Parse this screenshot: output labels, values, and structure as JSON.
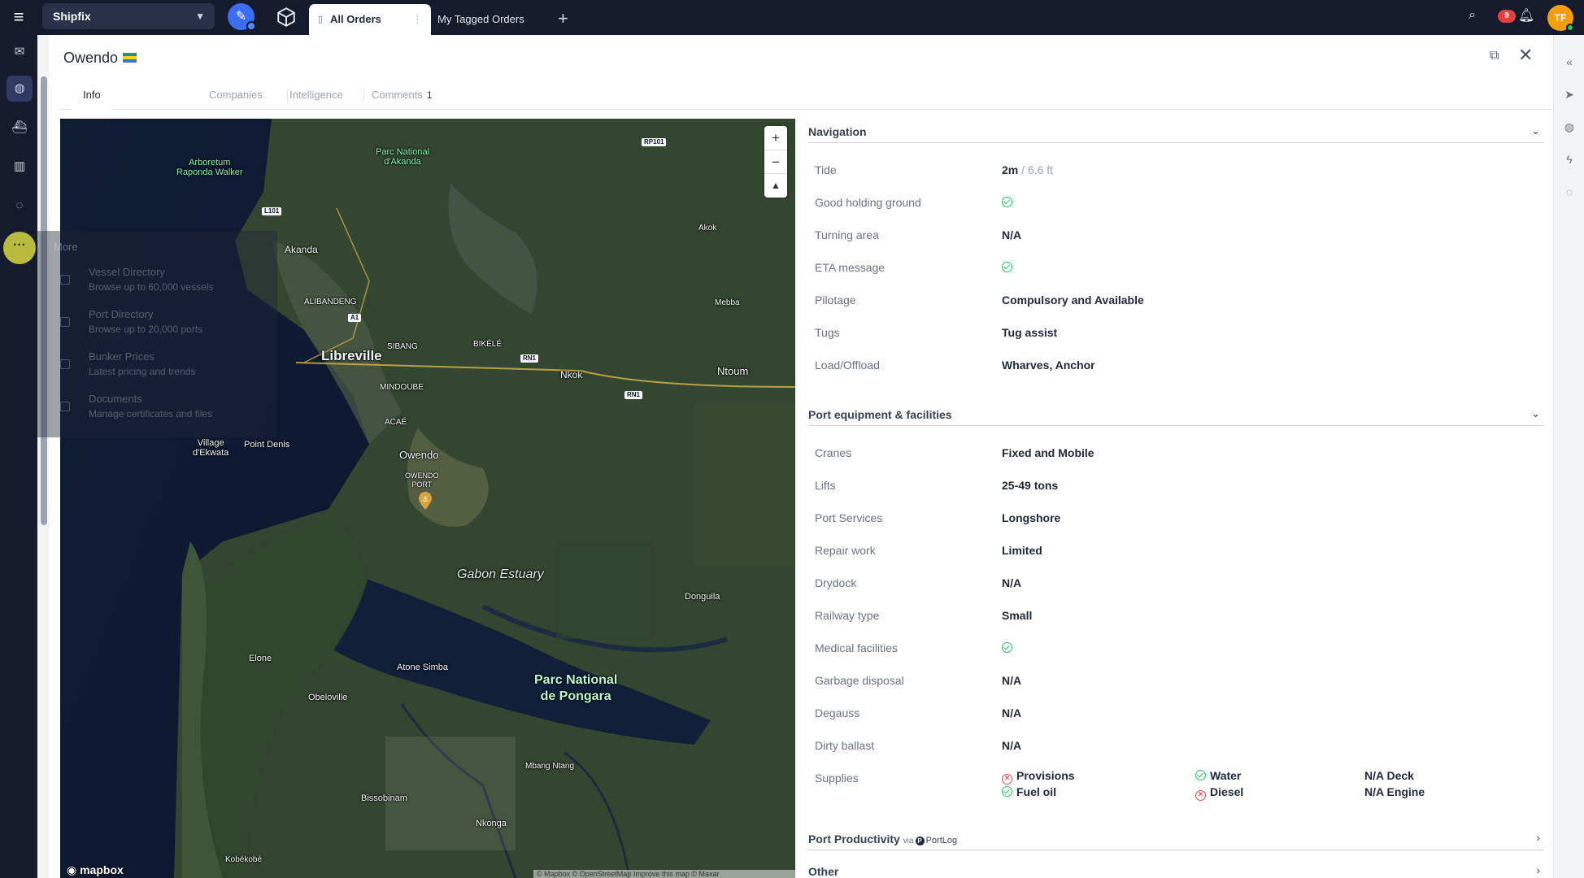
{
  "topbar": {
    "workspace": "Shipfix",
    "tabs": [
      {
        "label": "All Orders"
      },
      {
        "label": "My Tagged Orders"
      }
    ],
    "notification_count": "9",
    "avatar_initials": "TF"
  },
  "panel": {
    "title": "Owendo",
    "tabs": {
      "info": "Info",
      "companies": "Companies",
      "intelligence": "Intelligence",
      "comments": "Comments",
      "comments_count": "1"
    }
  },
  "more_menu": {
    "title": "More",
    "items": [
      {
        "title": "Vessel Directory",
        "subtitle": "Browse up to 60,000 vessels"
      },
      {
        "title": "Port Directory",
        "subtitle": "Browse up to 20,000 ports"
      },
      {
        "title": "Bunker Prices",
        "subtitle": "Latest pricing and trends"
      },
      {
        "title": "Documents",
        "subtitle": "Manage certificates and files"
      }
    ]
  },
  "map": {
    "labels": {
      "arboretum": "Arboretum\nRaponda Walker",
      "parc_akanda": "Parc National\nd'Akanda",
      "akanda": "Akanda",
      "alibandeng": "ALIBANDENG",
      "libreville": "Libreville",
      "sibang": "SIBANG",
      "bikele": "BIKÉLÉ",
      "mindoube": "MINDOUBE",
      "acae": "ACAÉ",
      "owendo": "Owendo",
      "owendo_port": "OWENDO\nPORT",
      "nkok": "Nkok",
      "ntoum": "Ntoum",
      "akok": "Akok",
      "mebba": "Mebba",
      "village_dekwata": "Village\nd'Ekwata",
      "point_denis": "Point Denis",
      "gabon_estuary": "Gabon Estuary",
      "donguila": "Donguila",
      "elone": "Elone",
      "atone_simba": "Atone Simba",
      "obeloville": "Obeloville",
      "parc_pongara": "Parc National\nde Pongara",
      "mbang_ntang": "Mbang Ntang",
      "bissobinam": "Bissobinam",
      "nkonga": "Nkonga",
      "kobekobe": "Kobékobé"
    },
    "roads": {
      "rp101": "RP101",
      "l101": "L101",
      "a1": "A1",
      "rn1_a": "RN1",
      "rn1_b": "RN1"
    },
    "logo": "mapbox",
    "attribution": "© Mapbox © OpenStreetMap Improve this map © Maxar"
  },
  "navigation": {
    "title": "Navigation",
    "tide_m": "2m",
    "tide_ft": " / 6.6 ft",
    "rows": [
      {
        "label": "Tide"
      },
      {
        "label": "Good holding ground",
        "value": "",
        "icon": "check"
      },
      {
        "label": "Turning area",
        "value": "N/A"
      },
      {
        "label": "ETA message",
        "value": "",
        "icon": "check"
      },
      {
        "label": "Pilotage",
        "value": "Compulsory and Available"
      },
      {
        "label": "Tugs",
        "value": "Tug assist"
      },
      {
        "label": "Load/Offload",
        "value": "Wharves, Anchor"
      }
    ]
  },
  "facilities": {
    "title": "Port equipment & facilities",
    "rows": [
      {
        "label": "Cranes",
        "value": "Fixed and Mobile"
      },
      {
        "label": "Lifts",
        "value": "25-49 tons"
      },
      {
        "label": "Port Services",
        "value": "Longshore"
      },
      {
        "label": "Repair work",
        "value": "Limited"
      },
      {
        "label": "Drydock",
        "value": "N/A"
      },
      {
        "label": "Railway type",
        "value": "Small"
      },
      {
        "label": "Medical facilities",
        "value": "",
        "icon": "check"
      },
      {
        "label": "Garbage disposal",
        "value": "N/A"
      },
      {
        "label": "Degauss",
        "value": "N/A"
      },
      {
        "label": "Dirty ballast",
        "value": "N/A"
      },
      {
        "label": "Supplies"
      }
    ],
    "supplies": {
      "provisions": "Provisions",
      "water": "Water",
      "deck": "N/A Deck",
      "fuel_oil": "Fuel oil",
      "diesel": "Diesel",
      "engine": "N/A Engine"
    }
  },
  "productivity": {
    "title": "Port Productivity",
    "via": "via",
    "source": "PortLog"
  },
  "other": {
    "title": "Other"
  },
  "colors": {
    "topbar": "#151a2d",
    "accent": "#3b6df0",
    "ok": "#22c55e",
    "bad": "#ef4444"
  }
}
